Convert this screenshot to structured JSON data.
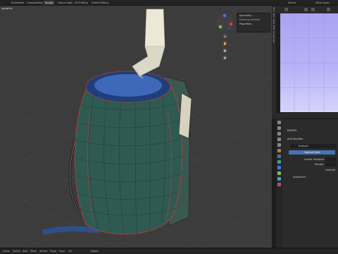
{
  "topbar": {
    "tabs": [
      {
        "label": "Animation"
      },
      {
        "label": "Compositing"
      },
      {
        "label": "Sculpt"
      },
      {
        "label": "Game Logic"
      },
      {
        "label": "UV Editing"
      },
      {
        "label": "Video Editing"
      }
    ],
    "scene_label": "Scene",
    "view_layer_label": "View Layer"
  },
  "viewport": {
    "title": "ographic",
    "overlay_panel": {
      "header": "Symmetry",
      "line1": "Dashing selected",
      "section": "Properties"
    },
    "vertical_tabs": [
      "Item",
      "Tool",
      "View",
      "Edit",
      "Screencast"
    ]
  },
  "properties": {
    "object_name": "BARREL",
    "add_modifier_label": "Add Modifier",
    "modifier_name": "Subsurf",
    "apply_label": "Catmull-Clark",
    "levels_viewport_label": "Levels Viewport",
    "render_label": "Render",
    "optimal_label": "Optimal",
    "advanced_label": "Advanced"
  },
  "statusbar": {
    "items": [
      "Draw",
      "Select",
      "Add",
      "Mesh",
      "Vertex",
      "Edge",
      "Face",
      "UV"
    ],
    "mode_label": "Global"
  },
  "colors": {
    "viewport_bg": "#3c3c3c",
    "barrel_body": "#2f5a52",
    "barrel_edge": "#cf3a3a",
    "lid": "#3f68b8",
    "pipe": "#ece8d8",
    "uv_bg": "#b3aff6",
    "accent": "#4772b3"
  }
}
